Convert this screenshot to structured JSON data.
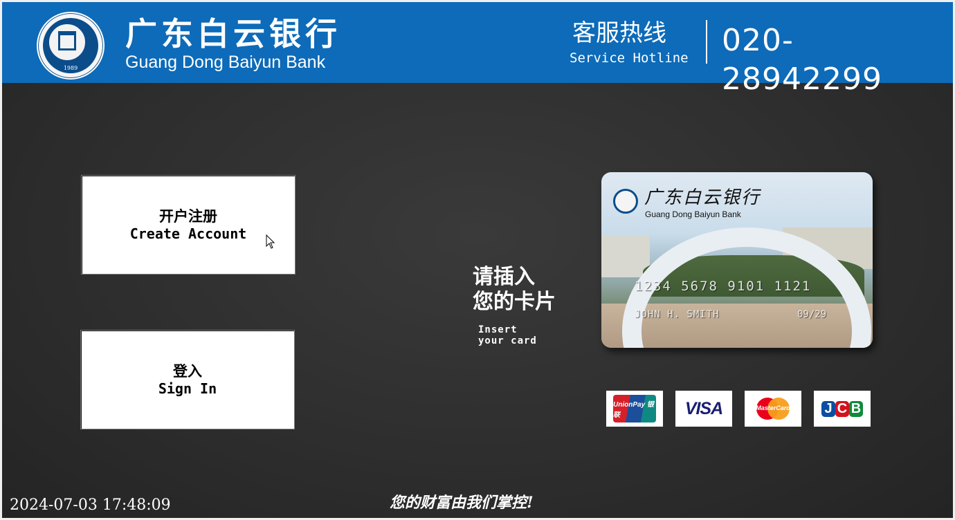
{
  "header": {
    "bank_name_cn": "广东白云银行",
    "bank_name_en": "Guang Dong Baiyun Bank",
    "logo": {
      "icon": "university-seal-icon",
      "year": "1989"
    },
    "hotline_label_cn": "客服热线",
    "hotline_label_en": "Service Hotline",
    "hotline_number": "020-28942299",
    "background_color": "#0d6bb9"
  },
  "actions": {
    "create_account": {
      "label_cn": "开户注册",
      "label_en": "Create Account"
    },
    "sign_in": {
      "label_cn": "登入",
      "label_en": "Sign In"
    }
  },
  "insert_card": {
    "prompt_cn_line1": "请插入",
    "prompt_cn_line2": "您的卡片",
    "prompt_en_line1": "Insert",
    "prompt_en_line2": "your card"
  },
  "card": {
    "bank_name_cn": "广东白云银行",
    "bank_name_en": "Guang Dong Baiyun Bank",
    "number": "1234  5678  9101  1121",
    "holder": "JOHN  H.  SMITH",
    "expiry": "09/29"
  },
  "payment_networks": [
    {
      "name": "UnionPay",
      "label": "UnionPay 银联"
    },
    {
      "name": "VISA",
      "label": "VISA"
    },
    {
      "name": "MasterCard",
      "label": "MasterCard"
    },
    {
      "name": "JCB",
      "label": "JCB"
    }
  ],
  "footer": {
    "datetime": "2024-07-03 17:48:09",
    "slogan": "您的财富由我们掌控!"
  }
}
